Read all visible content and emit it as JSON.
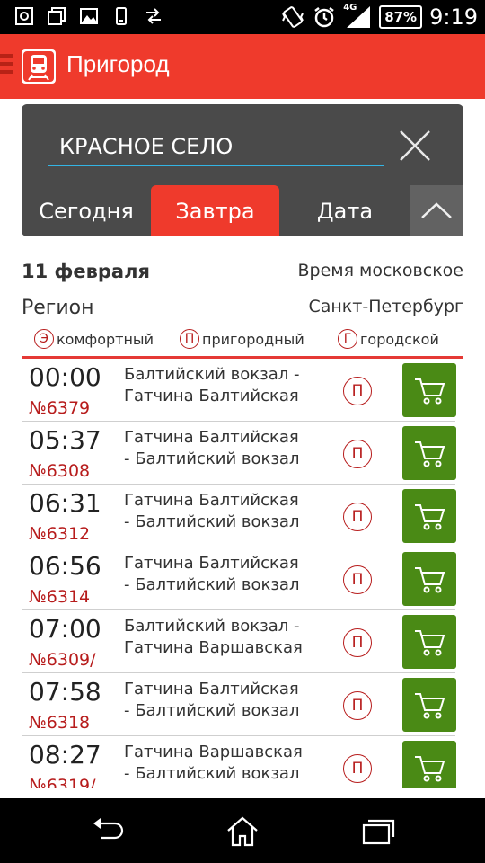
{
  "status_bar": {
    "network": "4G",
    "battery": "87%",
    "time": "9:19"
  },
  "app": {
    "title": "Пригород",
    "icons": {
      "menu": "menu-lines-icon",
      "logo": "train-icon"
    }
  },
  "search": {
    "station_value": "КРАСНОЕ СЕЛО",
    "clear_icon": "close-icon",
    "tabs": [
      {
        "label": "Сегодня",
        "selected": false
      },
      {
        "label": "Завтра",
        "selected": true
      },
      {
        "label": "Дата",
        "selected": false
      }
    ],
    "collapse_icon": "chevron-up-icon"
  },
  "info": {
    "date": "11 февраля",
    "timezone": "Время московское",
    "region_label": "Регион",
    "region_value": "Санкт-Петербург"
  },
  "legend": [
    {
      "badge": "Э",
      "label": "комфортный"
    },
    {
      "badge": "П",
      "label": "пригородный"
    },
    {
      "badge": "Г",
      "label": "городской"
    }
  ],
  "trains": [
    {
      "time": "00:00",
      "number": "№6379",
      "route_line1": "Балтийский вокзал -",
      "route_line2": "Гатчина Балтийская",
      "type": "П"
    },
    {
      "time": "05:37",
      "number": "№6308",
      "route_line1": "Гатчина Балтийская",
      "route_line2": "- Балтийский вокзал",
      "type": "П"
    },
    {
      "time": "06:31",
      "number": "№6312",
      "route_line1": "Гатчина Балтийская",
      "route_line2": "- Балтийский вокзал",
      "type": "П"
    },
    {
      "time": "06:56",
      "number": "№6314",
      "route_line1": "Гатчина Балтийская",
      "route_line2": "- Балтийский вокзал",
      "type": "П"
    },
    {
      "time": "07:00",
      "number": "№6309/",
      "route_line1": "Балтийский вокзал -",
      "route_line2": "Гатчина Варшавская",
      "type": "П"
    },
    {
      "time": "07:58",
      "number": "№6318",
      "route_line1": "Гатчина Балтийская",
      "route_line2": "- Балтийский вокзал",
      "type": "П"
    },
    {
      "time": "08:27",
      "number": "№6319/",
      "route_line1": "Гатчина Варшавская",
      "route_line2": "- Балтийский вокзал",
      "type": "П"
    }
  ],
  "colors": {
    "accent": "#ef3a2c",
    "panel": "#4a4a4a",
    "buy": "#4a8a15",
    "train_number": "#b71c1c",
    "input_underline": "#33b5e5"
  },
  "nav": {
    "back_icon": "back-icon",
    "home_icon": "home-icon",
    "recents_icon": "recent-apps-icon"
  }
}
